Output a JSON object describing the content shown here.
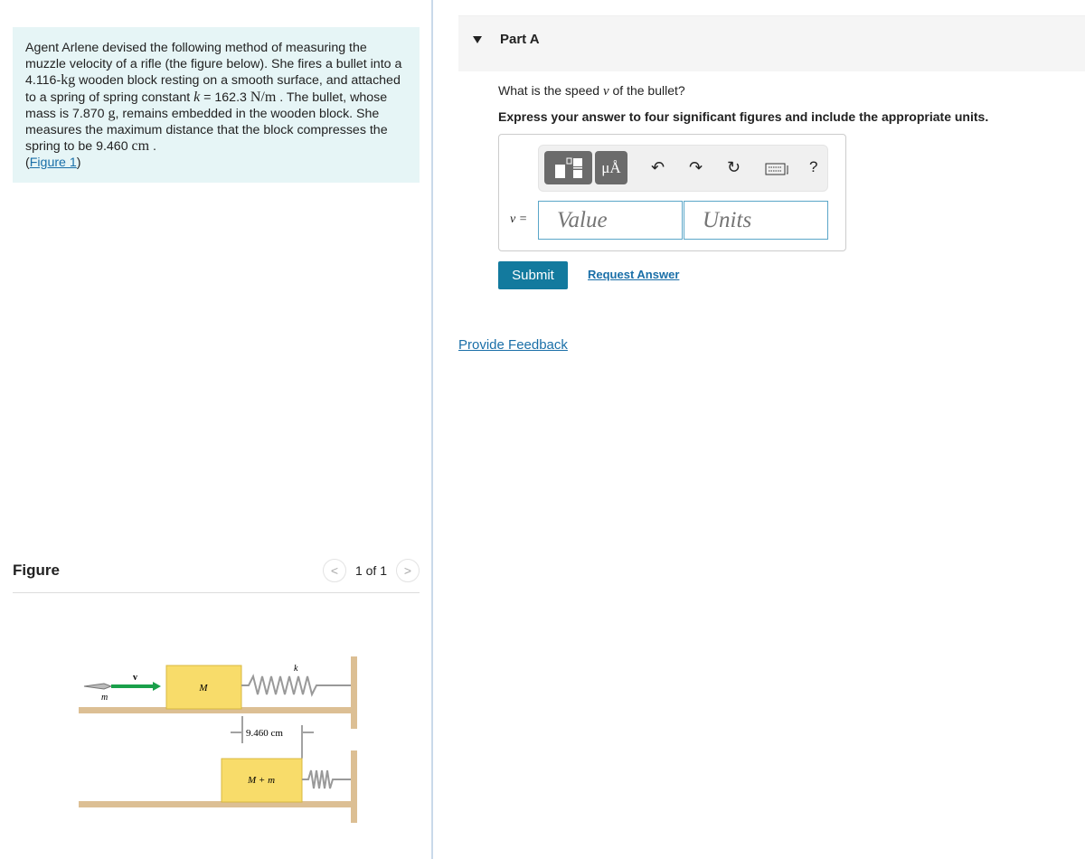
{
  "problem": {
    "p1": "Agent Arlene devised the following method of measuring the muzzle velocity of a rifle (the figure below). She fires a bullet into a ",
    "block_mass": "4.116-",
    "kg": "kg",
    "p2": " wooden block resting on a smooth surface, and attached to a spring of spring constant ",
    "k": "k",
    "k_eq": " = 162.3 ",
    "nm": "N/m",
    "p3": " . The bullet, whose mass is 7.870 ",
    "g": "g",
    "p4": ", remains embedded in the wooden block. She measures the maximum distance that the block compresses the spring to be 9.460 ",
    "cm": "cm",
    "p5": " .",
    "figure_link": "Figure 1"
  },
  "figure": {
    "title": "Figure",
    "pager": "1 of 1",
    "labels": {
      "v": "v",
      "m": "m",
      "M": "M",
      "k": "k",
      "distance": "9.460 cm",
      "Mm": "M + m"
    },
    "colors": {
      "block": "#f8dc6a",
      "wall": "#dcbf94",
      "arrow": "#1aa04a"
    }
  },
  "part": {
    "title": "Part A",
    "question_pre": "What is the speed ",
    "question_var": "v",
    "question_post": " of the bullet?",
    "instructions": "Express your answer to four significant figures and include the appropriate units.",
    "var_label": "v =",
    "value_placeholder": "Value",
    "units_placeholder": "Units",
    "units_button": "μÅ",
    "toolbar_icons": [
      "templates-icon",
      "units-icon",
      "undo-icon",
      "redo-icon",
      "reset-icon",
      "keyboard-icon",
      "help-icon"
    ],
    "help": "?",
    "submit": "Submit",
    "request_answer": "Request Answer"
  },
  "feedback": "Provide Feedback"
}
